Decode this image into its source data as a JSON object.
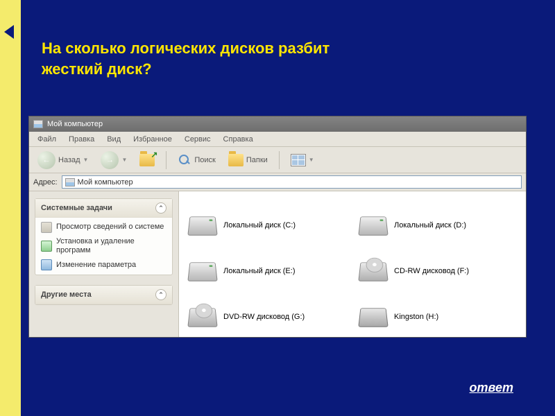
{
  "slide": {
    "title": "На сколько логических дисков разбит жесткий диск?",
    "answer_label": "ответ"
  },
  "titlebar": "Мой компьютер",
  "menu": [
    "Файл",
    "Правка",
    "Вид",
    "Избранное",
    "Сервис",
    "Справка"
  ],
  "toolbar": {
    "back_label": "Назад",
    "search_label": "Поиск",
    "folders_label": "Папки"
  },
  "address": {
    "label": "Адрес:",
    "value": "Мой компьютер"
  },
  "sidebar": {
    "panels": [
      {
        "title": "Системные задачи",
        "items": [
          "Просмотр сведений о системе",
          "Установка и удаление программ",
          "Изменение параметра"
        ]
      },
      {
        "title": "Другие места",
        "items": []
      }
    ]
  },
  "drives": [
    {
      "label": "Локальный диск (C:)",
      "kind": "hdd"
    },
    {
      "label": "Локальный диск (D:)",
      "kind": "hdd"
    },
    {
      "label": "Локальный диск (E:)",
      "kind": "hdd"
    },
    {
      "label": "CD-RW дисковод (F:)",
      "kind": "opt"
    },
    {
      "label": "DVD-RW дисковод (G:)",
      "kind": "opt"
    },
    {
      "label": "Kingston (H:)",
      "kind": "flash"
    }
  ]
}
